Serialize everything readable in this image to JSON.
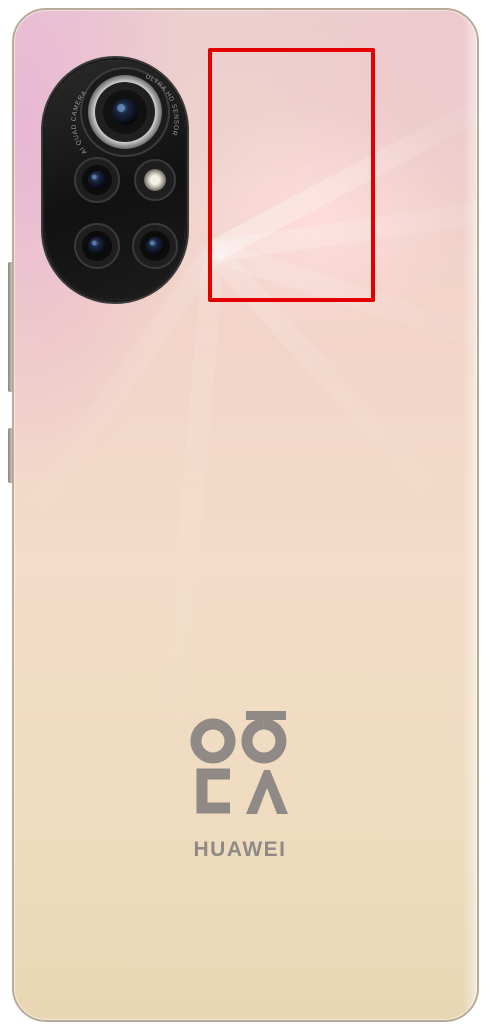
{
  "phone": {
    "brand_name": "HUAWEI",
    "camera_ring_text_left": "AI QUAD CAMERA",
    "camera_ring_text_right": "ULTRA HD SENSOR",
    "logo": "nova-logo"
  },
  "highlight": {
    "color": "#e40000",
    "label": ""
  },
  "colors": {
    "body_pink": "#eccfcf",
    "body_gold": "#e8d6b4",
    "camera_black": "#111111",
    "logo_gray": "#8f8a86"
  }
}
